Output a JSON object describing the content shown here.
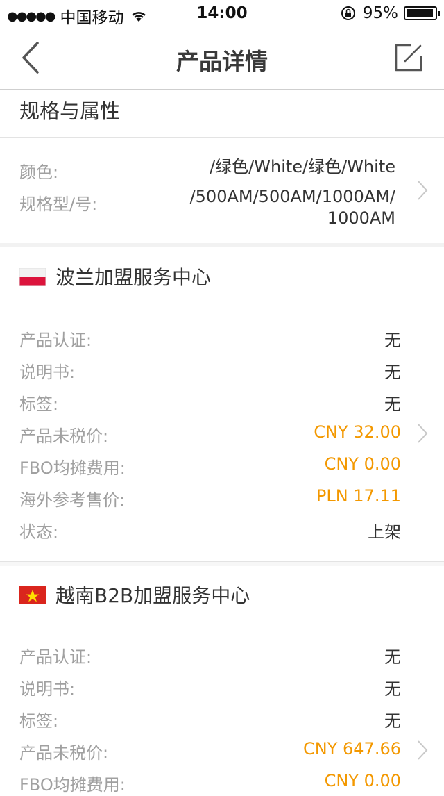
{
  "status_bar": {
    "signal": "●●●●●",
    "carrier": "中国移动",
    "time": "14:00",
    "battery": "95%",
    "battery_level": 0.95
  },
  "nav": {
    "title": "产品详情",
    "back_icon": "chevron-left-icon",
    "edit_icon": "edit-icon"
  },
  "section": {
    "title": "规格与属性"
  },
  "attributes": {
    "color_label": "颜色:",
    "color_value": "/绿色/White/绿色/White",
    "spec_label": "规格型/号:",
    "spec_value_line1": "/500AM/500AM/1000AM/",
    "spec_value_line2": "1000AM"
  },
  "branches": [
    {
      "flag": "poland-flag",
      "name": "波兰加盟服务中心",
      "rows": [
        {
          "label": "产品认证:",
          "value": "无"
        },
        {
          "label": "说明书:",
          "value": "无"
        },
        {
          "label": "标签:",
          "value": "无"
        },
        {
          "label": "产品未税价:",
          "value": "CNY 32.00",
          "highlight": true
        },
        {
          "label": "FBO均摊费用:",
          "value": "CNY 0.00",
          "highlight": true
        },
        {
          "label": "海外参考售价:",
          "value": "PLN 17.11",
          "highlight": true
        },
        {
          "label": "状态:",
          "value": "上架"
        }
      ]
    },
    {
      "flag": "vietnam-flag",
      "name": "越南B2B加盟服务中心",
      "rows": [
        {
          "label": "产品认证:",
          "value": "无"
        },
        {
          "label": "说明书:",
          "value": "无"
        },
        {
          "label": "标签:",
          "value": "无"
        },
        {
          "label": "产品未税价:",
          "value": "CNY 647.66",
          "highlight": true
        },
        {
          "label": "FBO均摊费用:",
          "value": "CNY 0.00",
          "highlight": true
        }
      ]
    }
  ],
  "colors": {
    "accent": "#f39800",
    "label": "#a0a0a0",
    "text": "#333333"
  }
}
